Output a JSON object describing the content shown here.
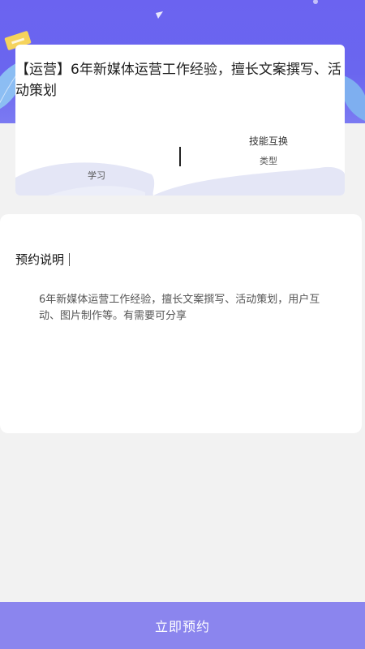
{
  "card": {
    "title": "【运营】6年新媒体运营工作经验，擅长文案撰写、活动策划",
    "stats": {
      "left_value": "",
      "left_label": "学习",
      "right_value": "技能互换",
      "right_label": "类型"
    }
  },
  "description": {
    "heading": "预约说明",
    "body": "6年新媒体运营工作经验，擅长文案撰写、活动策划，用户互动、图片制作等。有需要可分享"
  },
  "action": {
    "book_label": "立即预约"
  },
  "colors": {
    "header": "#6b63f0",
    "button": "#8b85ee",
    "page_bg": "#f2f2f2"
  },
  "icons": {
    "badge": "sticker-badge-icon",
    "leaf_left": "leaf-decoration-icon",
    "leaf_right": "leaf-decoration-icon"
  }
}
